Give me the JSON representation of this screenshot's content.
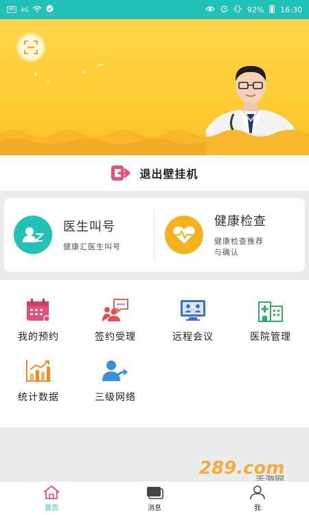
{
  "status_bar": {
    "left_icons": [
      "HD",
      "4G",
      "wifi-icon",
      "sync-icon"
    ],
    "battery": "92%",
    "time": "16:30"
  },
  "hero": {
    "scan_icon": "scan-icon"
  },
  "exit": {
    "label": "退出壁挂机",
    "icon": "exit-icon",
    "icon_color": "#e94e77"
  },
  "cards": [
    {
      "title": "医生叫号",
      "subtitle": "健康汇医生叫号",
      "icon": "doctor-call-icon",
      "color": "#22c2b6"
    },
    {
      "title": "健康检查",
      "subtitle_line1": "健康检查推荐",
      "subtitle_line2": "与确认",
      "icon": "heart-monitor-icon",
      "color": "#f5b21c"
    }
  ],
  "grid": [
    {
      "label": "我的预约",
      "icon": "calendar-icon",
      "color": "#e94e77"
    },
    {
      "label": "签约受理",
      "icon": "team-chat-icon",
      "color": "#e94e4e"
    },
    {
      "label": "远程会议",
      "icon": "video-conference-icon",
      "color": "#3a6fd8"
    },
    {
      "label": "医院管理",
      "icon": "hospital-building-icon",
      "color": "#2fae6a"
    },
    {
      "label": "统计数据",
      "icon": "bar-chart-icon",
      "color": "#f08a24"
    },
    {
      "label": "三级网络",
      "icon": "share-network-icon",
      "color": "#3a8fe0"
    }
  ],
  "tabbar": [
    {
      "label": "首页",
      "icon": "home-icon",
      "active": true
    },
    {
      "label": "消息",
      "icon": "message-icon",
      "active": false
    },
    {
      "label": "我",
      "icon": "profile-icon",
      "active": false
    }
  ],
  "watermark": {
    "brand": "289.com",
    "subtitle": "手游网"
  },
  "colors": {
    "accent": "#22c2b6",
    "hero_yellow": "#ffcc33"
  }
}
